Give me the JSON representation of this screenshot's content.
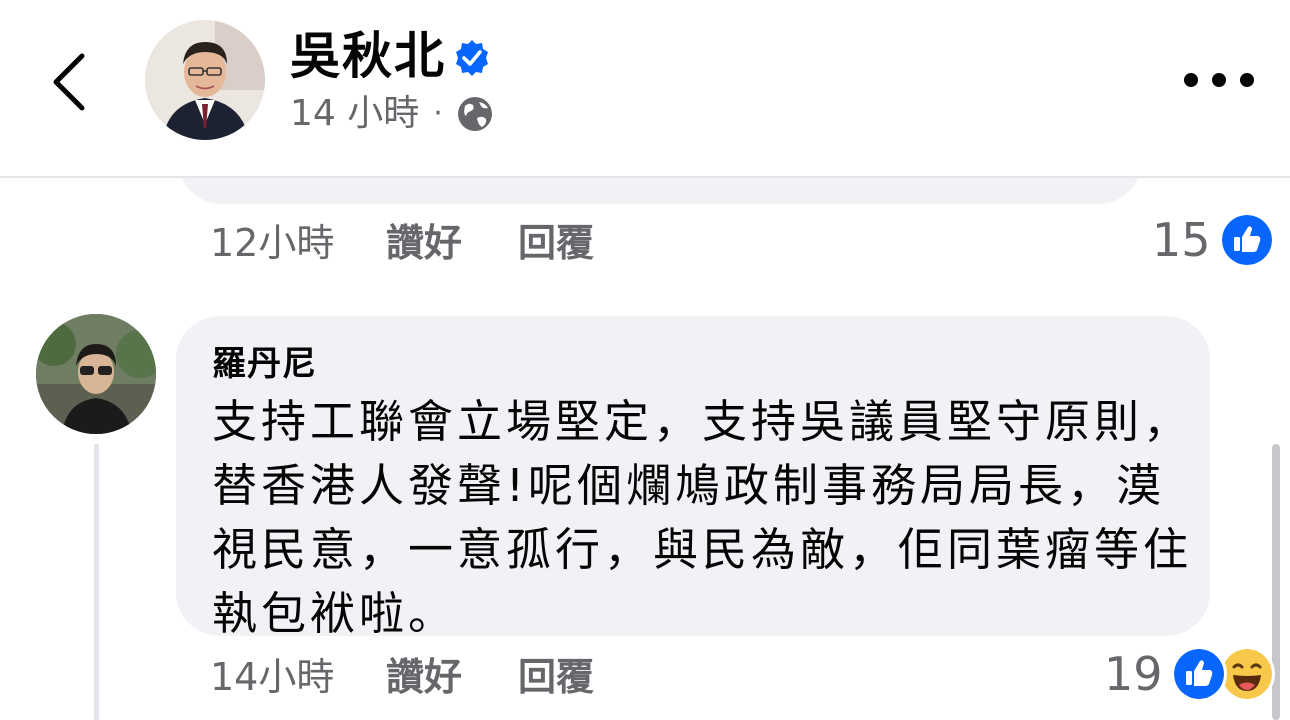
{
  "header": {
    "author_name": "吳秋北",
    "post_time": "14 小時",
    "separator": "·",
    "icons": {
      "back": "chevron-left-icon",
      "verified": "verified-badge-icon",
      "audience": "globe-icon",
      "more": "more-horizontal-icon"
    }
  },
  "previous_comment": {
    "time": "12小時",
    "like_label": "讚好",
    "reply_label": "回覆",
    "reaction_count": "15",
    "reactions": [
      "like-reaction-icon"
    ]
  },
  "comment": {
    "author": "羅丹尼",
    "text": "支持工聯會立場堅定，支持吳議員堅守原則，替香港人發聲!呢個爛鳩政制事務局局長，漠視民意，一意孤行，與民為敵，佢同葉瘤等住執包袱啦。",
    "time": "14小時",
    "like_label": "讚好",
    "reply_label": "回覆",
    "reaction_count": "19",
    "reactions": [
      "like-reaction-icon",
      "haha-reaction-icon"
    ]
  },
  "colors": {
    "accent_blue": "#0866ff",
    "bubble_bg": "#f0f2f5",
    "secondary_text": "#65676b",
    "haha_yellow": "#f7c84a"
  }
}
